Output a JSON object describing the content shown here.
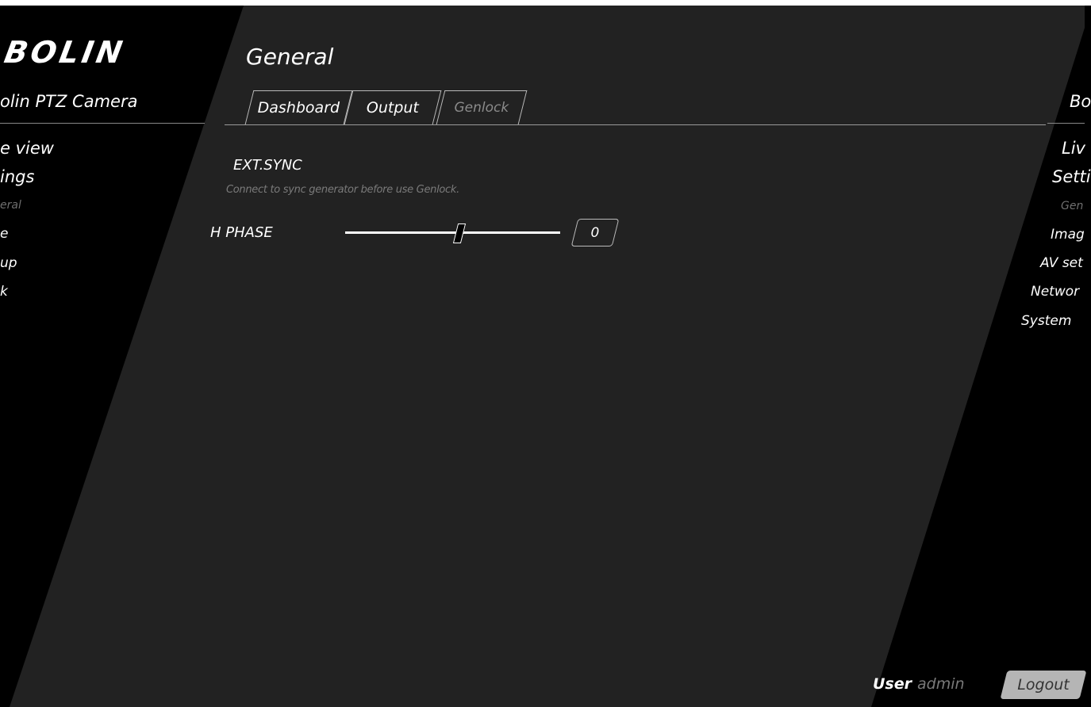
{
  "app": {
    "logo_text": "BOLIN",
    "camera_name_left": "olin PTZ Camera",
    "camera_name_right": "Bo"
  },
  "left_nav": [
    {
      "label": "e view"
    },
    {
      "label": "ings"
    },
    {
      "label": "eral"
    },
    {
      "label": "e"
    },
    {
      "label": "up"
    },
    {
      "label": "k"
    }
  ],
  "right_nav": [
    {
      "label": "Liv"
    },
    {
      "label": "Setti"
    },
    {
      "label": "Gen"
    },
    {
      "label": "Imag"
    },
    {
      "label": "AV set"
    },
    {
      "label": "Networ"
    },
    {
      "label": "System"
    }
  ],
  "header": {
    "title": "General"
  },
  "tabs": [
    {
      "label": "Dashboard",
      "active": false
    },
    {
      "label": "Output",
      "active": false
    },
    {
      "label": "Genlock",
      "active": true
    }
  ],
  "genlock": {
    "section_title": "EXT.SYNC",
    "hint": "Connect to sync generator before use Genlock.",
    "h_phase_label": "H PHASE",
    "h_phase_value": "0",
    "h_phase_slider_fraction": 0.53
  },
  "footer": {
    "user_label": "User",
    "user_value": "admin",
    "logout_label": "Logout"
  },
  "colors": {
    "background": "#000000",
    "panel": "#222222",
    "muted_text": "#7a7a7a",
    "active_nav": "#6f6f6f",
    "logout_bg": "#b5b5b5"
  }
}
